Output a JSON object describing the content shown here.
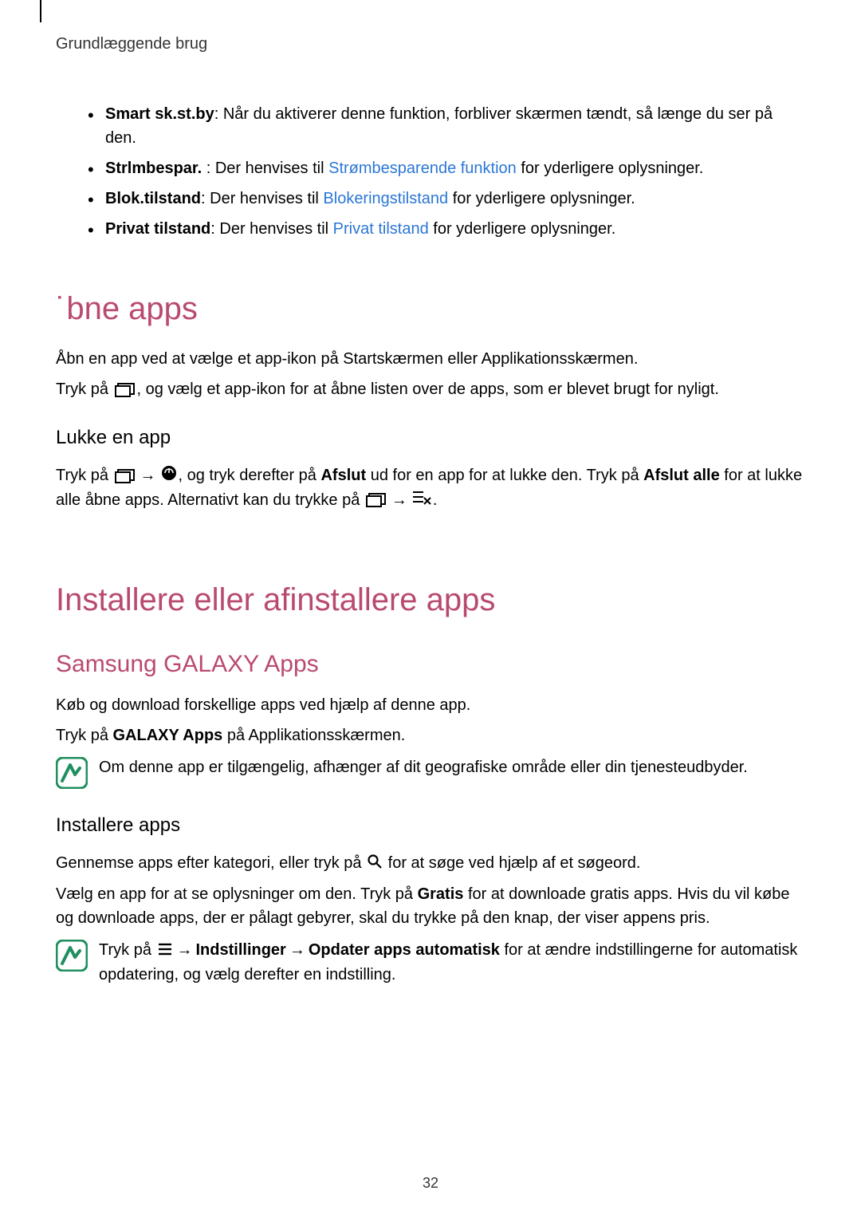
{
  "header": "Grundlæggende brug",
  "bullets": {
    "b1_bold": "Smart sk.st.by",
    "b1_rest": ": Når du aktiverer denne funktion, forbliver skærmen tændt, så længe du ser på den.",
    "b2_bold": "Strlmbespar. ",
    "b2_pre": ": Der henvises til ",
    "b2_link": "Strømbesparende funktion",
    "b2_post": " for yderligere oplysninger.",
    "b3_bold": "Blok.tilstand",
    "b3_pre": ": Der henvises til ",
    "b3_link": "Blokeringstilstand",
    "b3_post": " for yderligere oplysninger.",
    "b4_bold": "Privat tilstand",
    "b4_pre": ": Der henvises til ",
    "b4_link": "Privat tilstand",
    "b4_post": " for yderligere oplysninger."
  },
  "open_apps": {
    "heading": "Åbne apps",
    "heading_fallback": "˙bne apps",
    "p1": "Åbn en app ved at vælge et app-ikon på Startskærmen eller Applikationsskærmen.",
    "p2a": "Tryk på ",
    "p2b": ", og vælg et app-ikon for at åbne listen over de apps, som er blevet brugt for nyligt.",
    "close_heading": "Lukke en app",
    "p3a": "Tryk på ",
    "p3b": ", og tryk derefter på ",
    "p3_bold1": "Afslut",
    "p3c": " ud for en app for at lukke den. Tryk på ",
    "p3_bold2": "Afslut alle",
    "p3d": " for at lukke alle åbne apps. Alternativt kan du trykke på "
  },
  "install": {
    "heading": "Installere eller afinstallere apps",
    "galaxy_heading": "Samsung GALAXY Apps",
    "p1": "Køb og download forskellige apps ved hjælp af denne app.",
    "p2a": "Tryk på ",
    "p2_bold": "GALAXY Apps",
    "p2b": " på Applikationsskærmen.",
    "note1": "Om denne app er tilgængelig, afhænger af dit geografiske område eller din tjenesteudbyder.",
    "install_heading": "Installere apps",
    "p3a": "Gennemse apps efter kategori, eller tryk på ",
    "p3b": " for at søge ved hjælp af et søgeord.",
    "p4a": "Vælg en app for at se oplysninger om den. Tryk på ",
    "p4_bold": "Gratis",
    "p4b": " for at downloade gratis apps. Hvis du vil købe og downloade apps, der er pålagt gebyrer, skal du trykke på den knap, der viser appens pris.",
    "note2a": "Tryk på ",
    "note2_bold1": "Indstillinger",
    "note2_bold2": "Opdater apps automatisk",
    "note2b": " for at ændre indstillingerne for automatisk opdatering, og vælg derefter en indstilling."
  },
  "page_number": "32",
  "arrow": "→"
}
